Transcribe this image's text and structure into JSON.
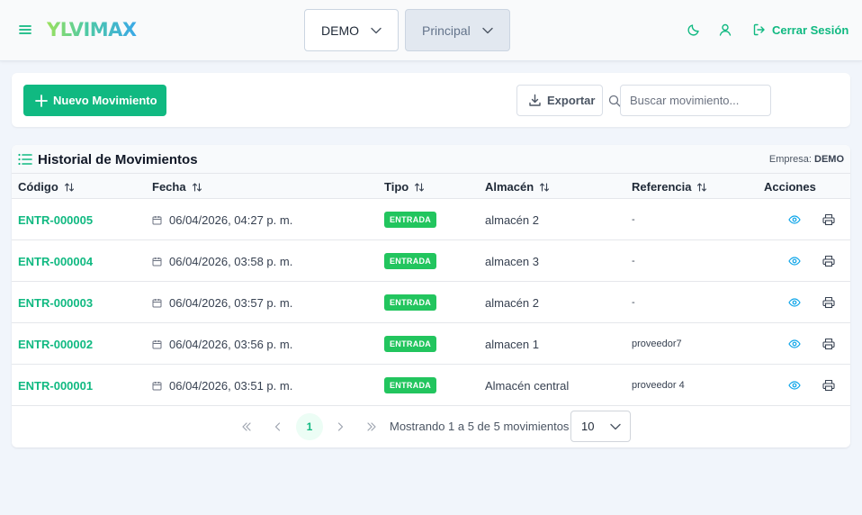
{
  "header": {
    "logo": "YLVIMAX",
    "company_select": "DEMO",
    "warehouse_select": "Principal",
    "logout_label": "Cerrar Sesión"
  },
  "toolbar": {
    "new_button": "Nuevo Movimiento",
    "export_button": "Exportar",
    "search_placeholder": "Buscar movimiento..."
  },
  "table": {
    "title": "Historial de Movimientos",
    "company_label": "Empresa:",
    "company_value": "DEMO",
    "columns": [
      "Código",
      "Fecha",
      "Tipo",
      "Almacén",
      "Referencia",
      "Acciones"
    ],
    "rows": [
      {
        "code": "ENTR-000005",
        "date": "06/04/2026, 04:27 p. m.",
        "type": "ENTRADA",
        "warehouse": "almacén 2",
        "reference": "-"
      },
      {
        "code": "ENTR-000004",
        "date": "06/04/2026, 03:58 p. m.",
        "type": "ENTRADA",
        "warehouse": "almacen 3",
        "reference": "-"
      },
      {
        "code": "ENTR-000003",
        "date": "06/04/2026, 03:57 p. m.",
        "type": "ENTRADA",
        "warehouse": "almacén 2",
        "reference": "-"
      },
      {
        "code": "ENTR-000002",
        "date": "06/04/2026, 03:56 p. m.",
        "type": "ENTRADA",
        "warehouse": "almacen 1",
        "reference": "proveedor7"
      },
      {
        "code": "ENTR-000001",
        "date": "06/04/2026, 03:51 p. m.",
        "type": "ENTRADA",
        "warehouse": "Almacén central",
        "reference": "proveedor 4"
      }
    ]
  },
  "pagination": {
    "current_page": "1",
    "info": "Mostrando 1 a 5 de 5 movimientos",
    "page_size": "10"
  },
  "colors": {
    "accent": "#10b981",
    "badge": "#22c55e",
    "eye_icon": "#0ea5e9"
  }
}
